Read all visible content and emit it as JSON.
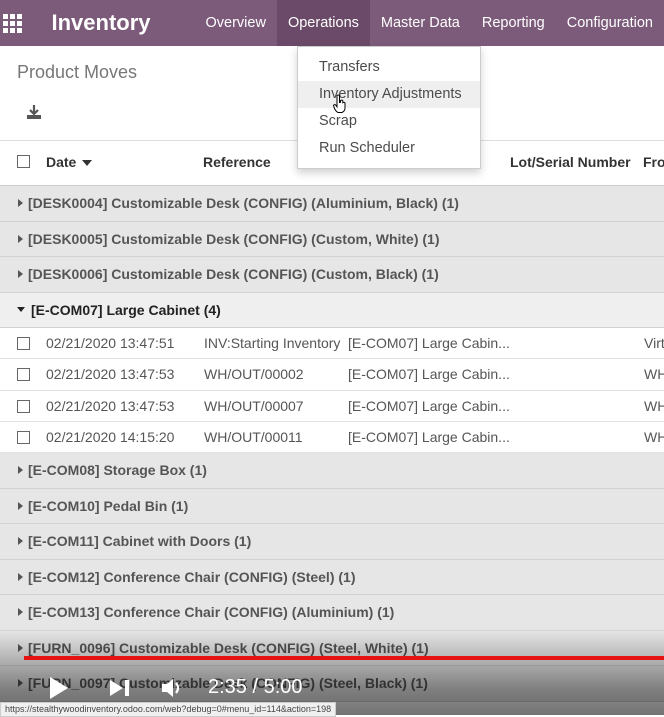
{
  "nav": {
    "apps_icon": "apps-grid-icon",
    "brand": "Inventory",
    "menu": [
      "Overview",
      "Operations",
      "Master Data",
      "Reporting",
      "Configuration"
    ]
  },
  "page": {
    "title": "Product Moves",
    "download_icon": "download-icon"
  },
  "table": {
    "headers": {
      "date": "Date",
      "reference": "Reference",
      "lot_serial": "Lot/Serial Number",
      "from": "Fro"
    }
  },
  "groups_before": [
    {
      "label": "[DESK0004] Customizable Desk (CONFIG) (Aluminium, Black) (1)"
    },
    {
      "label": "[DESK0005] Customizable Desk (CONFIG) (Custom, White) (1)"
    },
    {
      "label": "[DESK0006] Customizable Desk (CONFIG) (Custom, Black) (1)"
    }
  ],
  "open_group": {
    "label": "[E-COM07] Large Cabinet (4)",
    "rows": [
      {
        "date": "02/21/2020 13:47:51",
        "reference": "INV:Starting Inventory",
        "product": "[E-COM07] Large Cabin...",
        "from": "Virt"
      },
      {
        "date": "02/21/2020 13:47:53",
        "reference": "WH/OUT/00002",
        "product": "[E-COM07] Large Cabin...",
        "from": "WH"
      },
      {
        "date": "02/21/2020 13:47:53",
        "reference": "WH/OUT/00007",
        "product": "[E-COM07] Large Cabin...",
        "from": "WH"
      },
      {
        "date": "02/21/2020 14:15:20",
        "reference": "WH/OUT/00011",
        "product": "[E-COM07] Large Cabin...",
        "from": "WH"
      }
    ]
  },
  "groups_after": [
    {
      "label": "[E-COM08] Storage Box (1)"
    },
    {
      "label": "[E-COM10] Pedal Bin (1)"
    },
    {
      "label": "[E-COM11] Cabinet with Doors (1)"
    },
    {
      "label": "[E-COM12] Conference Chair (CONFIG) (Steel) (1)"
    },
    {
      "label": "[E-COM13] Conference Chair (CONFIG) (Aluminium) (1)"
    },
    {
      "label": "[FURN_0096] Customizable Desk (CONFIG) (Steel, White) (1)"
    },
    {
      "label": "[FURN_0097] Customizable Desk (CONFIG) (Steel, Black) (1)"
    }
  ],
  "dropdown": {
    "items": [
      "Transfers",
      "Inventory Adjustments",
      "Scrap",
      "Run Scheduler"
    ]
  },
  "video": {
    "time": "2:35 / 5:00",
    "progress": 0.517
  },
  "status_url": "https://stealthywoodinventory.odoo.com/web?debug=0#menu_id=114&action=198",
  "colors": {
    "navbar": "#7c5a7a",
    "progress": "#e51212"
  }
}
